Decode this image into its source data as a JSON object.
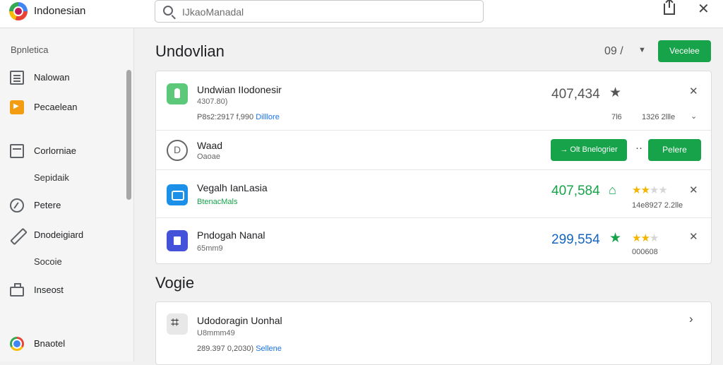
{
  "app": {
    "title": "Indonesian"
  },
  "search": {
    "placeholder": "IJkaoManadal"
  },
  "sidebar": {
    "section_label": "Bpnletica",
    "items": [
      {
        "label": "Nalowan",
        "icon": "document-icon"
      },
      {
        "label": "Pecaelean",
        "icon": "orange-app-icon"
      },
      {
        "label": "Corlorniae",
        "icon": "calendar-icon"
      },
      {
        "label": "Sepidaik",
        "icon": ""
      },
      {
        "label": "Petere",
        "icon": "compass-icon"
      },
      {
        "label": "Dnodeigiard",
        "icon": "pencil-icon"
      },
      {
        "label": "Socoie",
        "icon": ""
      },
      {
        "label": "Inseost",
        "icon": "box-icon"
      },
      {
        "label": "Bnaotel",
        "icon": "chrome-icon"
      }
    ]
  },
  "main": {
    "title": "Undovlian",
    "page_indicator": "09 /",
    "primary_button": "Vecelee",
    "rows": [
      {
        "title": "Undwian IIodonesir",
        "subtitle": "4307.80)",
        "meta": "P8s2:2917 f,990 ",
        "meta_link": "Dilllore",
        "value": "407,434",
        "value_color": "#555555",
        "small_left": "7l6",
        "small_right": "1326 2llle"
      },
      {
        "title": "Waad",
        "subtitle": "Oaoae",
        "action_label": "Olt Bnelogrier",
        "action_arrow": "→",
        "dots": "··",
        "button": "Pelere"
      },
      {
        "title": "Vegalh IanLasia",
        "subtitle": "BtenacMals",
        "value": "407,584",
        "value_color": "#16a34a",
        "rating": 2,
        "small_right": "14e8927 2.2lle"
      },
      {
        "title": "Pndogah Nanal",
        "subtitle": "65mm9",
        "value": "299,554",
        "value_color": "#1565c0",
        "rating": 2,
        "small_right": "000608"
      }
    ]
  },
  "section2": {
    "title": "Vogie",
    "row": {
      "title": "Udodoragin Uonhal",
      "subtitle": "U8mmm49",
      "meta": "289.397 0,2030) ",
      "meta_link": "Sellene"
    }
  },
  "colors": {
    "accent_green": "#16a34a",
    "link_blue": "#1a73e8",
    "star_gold": "#f4b400"
  }
}
